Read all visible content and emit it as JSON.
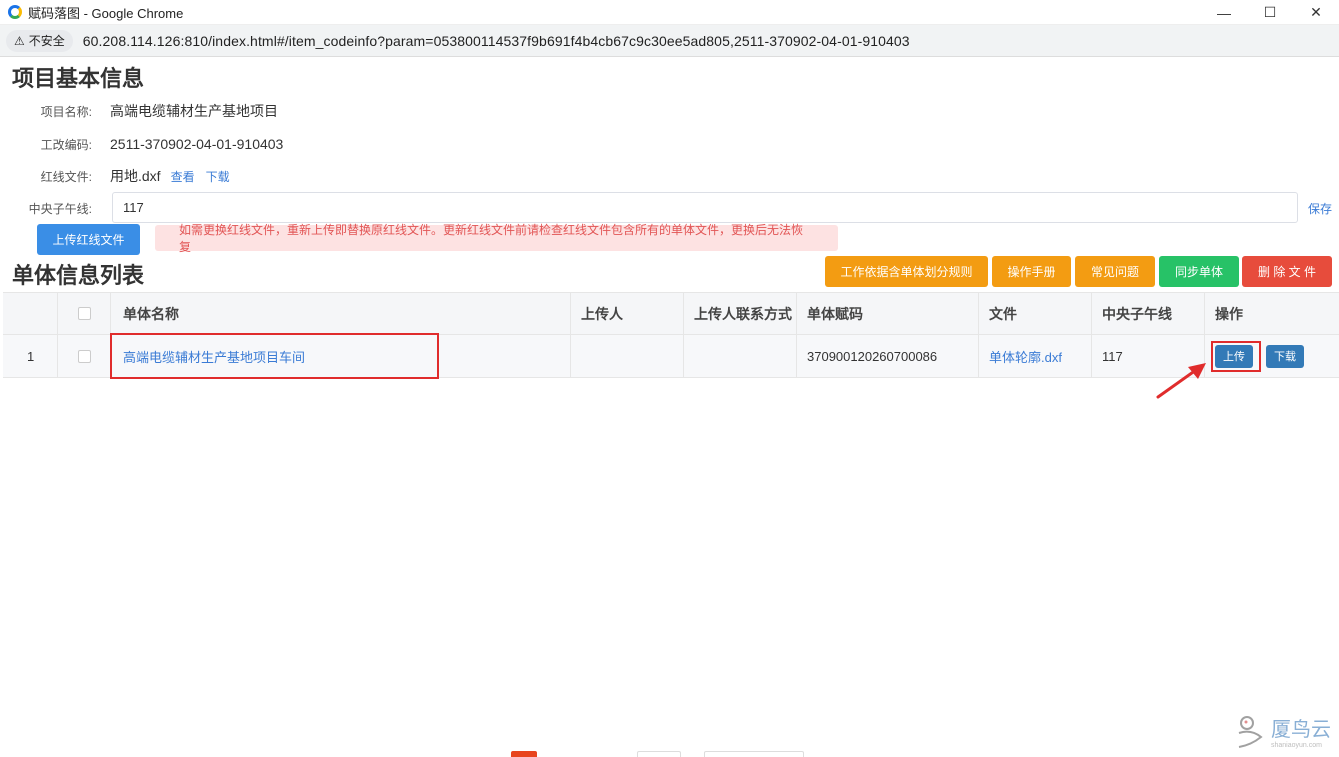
{
  "window": {
    "title": "赋码落图 - Google Chrome",
    "minimize_icon": "—",
    "maximize_icon": "☐",
    "close_icon": "✕"
  },
  "address_bar": {
    "security_label": "不安全",
    "url": "60.208.114.126:810/index.html#/item_codeinfo?param=053800114537f9b691f4b4cb67c9c30ee5ad805,2511-370902-04-01-910403"
  },
  "project_info": {
    "title": "项目基本信息",
    "name_label": "项目名称:",
    "name_value": "高端电缆辅材生产基地项目",
    "code_label": "工改编码:",
    "code_value": "2511-370902-04-01-910403",
    "redline_label": "红线文件:",
    "redline_file": "用地.dxf",
    "view_link": "查看",
    "download_link": "下载",
    "meridian_label": "中央子午线:",
    "meridian_value": "117",
    "save_link": "保存",
    "upload_redline_button": "上传红线文件",
    "notice": "如需更换红线文件，重新上传即替换原红线文件。更新红线文件前请检查红线文件包含所有的单体文件，更换后无法恢复"
  },
  "unit_list": {
    "title": "单体信息列表",
    "toolbar": {
      "rules_button": "工作依据含单体划分规则",
      "manual_button": "操作手册",
      "faq_button": "常见问题",
      "sync_button": "同步单体",
      "delete_button": "删 除 文 件"
    },
    "columns": [
      "单体名称",
      "上传人",
      "上传人联系方式",
      "单体赋码",
      "文件",
      "中央子午线",
      "操作"
    ],
    "rows": [
      {
        "index": "1",
        "name": "高端电缆辅材生产基地项目车间",
        "uploader": "",
        "contact": "",
        "code": "370900120260700086",
        "file": "单体轮廓.dxf",
        "meridian": "117",
        "upload_button": "上传",
        "download_button": "下载"
      }
    ]
  },
  "watermark": {
    "text": "厦鸟云",
    "sub": "shaniaoyun.com"
  }
}
